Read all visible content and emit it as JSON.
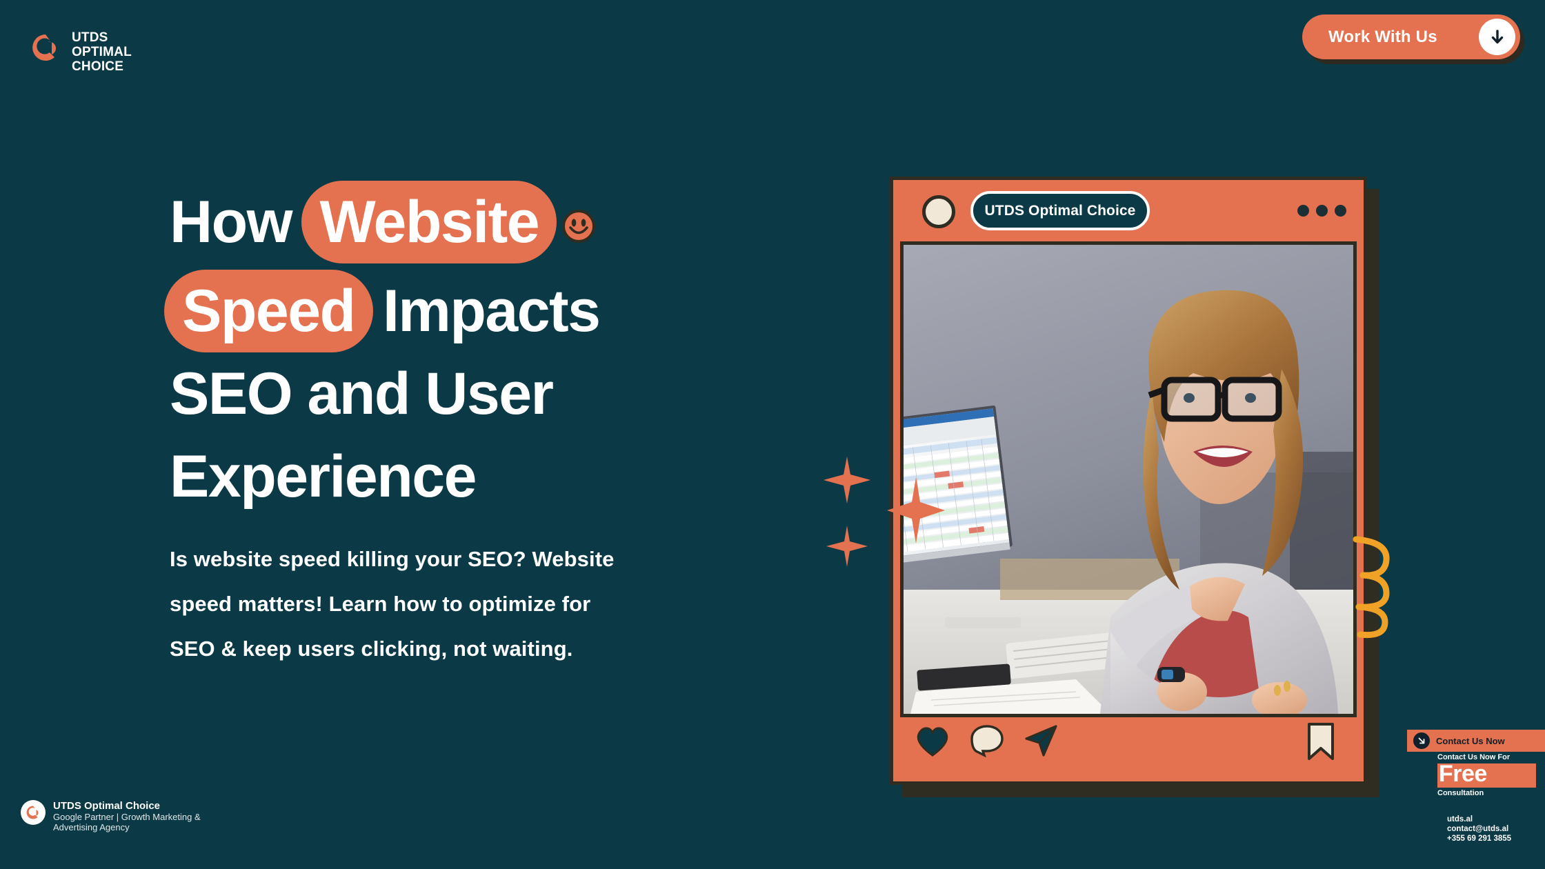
{
  "page": {
    "bg_color": "#0b3a46",
    "accent_color": "#e4714f",
    "ink_color": "#2f2c21",
    "cream_color": "#f2e8d8",
    "gold_color": "#f0a227"
  },
  "topbar": {
    "logo_icon": "utds-circle-logo-icon",
    "brand_line1": "UTDS",
    "brand_line2": "OPTIMAL",
    "brand_line3": "CHOICE",
    "cta_label": "Work With Us",
    "cta_icon": "arrow-down-icon"
  },
  "hero": {
    "headline_lines": [
      {
        "parts": [
          {
            "text": "How ",
            "highlight": false
          },
          {
            "text": "Website",
            "highlight": true
          }
        ],
        "smiley": true
      },
      {
        "parts": [
          {
            "text": "Speed",
            "highlight": true
          },
          {
            "text": " Impacts",
            "highlight": false
          }
        ],
        "smiley": false
      },
      {
        "parts": [
          {
            "text": "SEO and User",
            "highlight": false
          }
        ],
        "smiley": false
      },
      {
        "parts": [
          {
            "text": "Experience",
            "highlight": false
          }
        ],
        "smiley": false
      }
    ],
    "smiley_icon": "smiley-face-icon",
    "subtext": "Is website speed killing your SEO? Website speed matters! Learn how to optimize for SEO & keep users clicking, not waiting."
  },
  "post_card": {
    "avatar_icon": "avatar-icon",
    "username": "UTDS Optimal Choice",
    "more_options_icon": "three-dots-icon",
    "photo_alt": "smiling businesswoman with glasses at desk with spreadsheet monitor",
    "actions": [
      {
        "name": "like-icon",
        "label": "Like"
      },
      {
        "name": "comment-icon",
        "label": "Comment"
      },
      {
        "name": "share-icon",
        "label": "Share"
      }
    ],
    "save_icon": "bookmark-icon"
  },
  "decorations": {
    "sparkle_icon": "sparkle-star-icon",
    "sparkle_count": 3,
    "coil_icon": "spiral-coil-icon"
  },
  "footer_brand": {
    "logo_icon": "utds-circle-logo-icon",
    "name": "UTDS Optimal Choice",
    "tagline": "Google Partner | Growth Marketing & Advertising Agency"
  },
  "contact_widget": {
    "bar_icon": "arrow-down-right-icon",
    "bar_label": "Contact Us Now",
    "line1": "Contact Us Now For",
    "highlight": "Free",
    "line3": "Consultation",
    "website": "utds.al",
    "email": "contact@utds.al",
    "phone": "+355 69 291 3855"
  }
}
